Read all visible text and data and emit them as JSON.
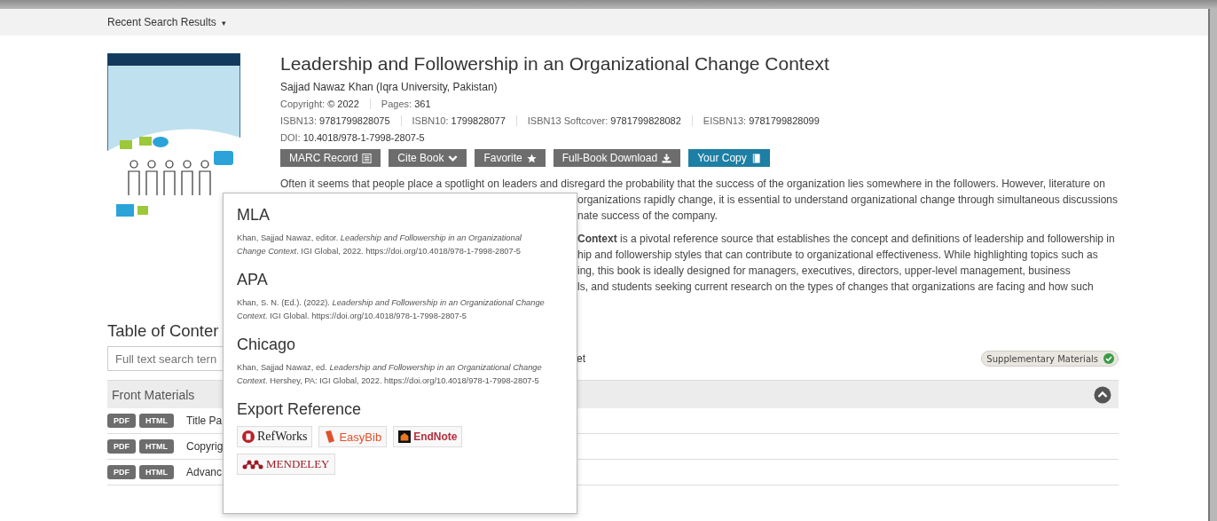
{
  "topbar": {
    "label": "Recent Search Results",
    "caret": "▾"
  },
  "book": {
    "title": "Leadership and Followership in an Organizational Change Context",
    "author": "Sajjad Nawaz Khan (Iqra University, Pakistan)",
    "meta_rows": [
      [
        {
          "label": "Copyright:",
          "value": "© 2022"
        },
        {
          "label": "Pages:",
          "value": "361"
        }
      ],
      [
        {
          "label": "ISBN13:",
          "value": "9781799828075"
        },
        {
          "label": "ISBN10:",
          "value": "1799828077"
        },
        {
          "label": "ISBN13 Softcover:",
          "value": "9781799828082"
        },
        {
          "label": "EISBN13:",
          "value": "9781799828099"
        }
      ],
      [
        {
          "label": "DOI:",
          "value": "10.4018/978-1-7998-2807-5"
        }
      ]
    ],
    "buttons": [
      {
        "label": "MARC Record",
        "kind": "list",
        "highlighted": false
      },
      {
        "label": "Cite Book",
        "kind": "dropdown",
        "highlighted": false
      },
      {
        "label": "Favorite",
        "kind": "favorite",
        "highlighted": false
      },
      {
        "label": "Full-Book Download",
        "kind": "download",
        "highlighted": false
      },
      {
        "label": "Your Copy",
        "kind": "copy",
        "highlighted": true
      }
    ],
    "description_first_line": "Often it seems that people place a spotlight on leaders and disregard the probability that the success of the organization lies somewhere in the followers. However, literature on",
    "description_fragments": [
      [
        "organizations rapidly change, it is essential to understand organizational change through simultaneous discussions",
        "nate success of the company."
      ],
      [
        "**Context** is a pivotal reference source that establishes the concept and definitions of leadership and followership in",
        "hip and followership styles that can contribute to organizational effectiveness. While highlighting topics such as",
        "ing, this book is ideally designed for managers, executives, directors, upper-level management, business",
        "ls, and students seeking current research on the types of changes that organizations are facing and how such"
      ]
    ]
  },
  "toc": {
    "heading": "Table of Conter",
    "search": {
      "placeholder": "Full text search tern"
    },
    "search_fragment": "et",
    "supplementary": "Supplementary Materials",
    "section": {
      "title": "Front Materials",
      "expanded": true
    },
    "rows": [
      {
        "formats": [
          "PDF",
          "HTML"
        ],
        "title": "Title Pa"
      },
      {
        "formats": [
          "PDF",
          "HTML"
        ],
        "title": "Copyrig"
      },
      {
        "formats": [
          "PDF",
          "HTML"
        ],
        "title": "Advanc"
      }
    ]
  },
  "cite_popup": {
    "styles": [
      {
        "name": "MLA",
        "citation": "Khan, Sajjad Nawaz, editor. *Leadership and Followership in an Organizational Change Context*. IGI Global, 2022. https://doi.org/10.4018/978-1-7998-2807-5"
      },
      {
        "name": "APA",
        "citation": "Khan, S. N. (Ed.). (2022). *Leadership and Followership in an Organizational Change Context*. IGI Global. https://doi.org/10.4018/978-1-7998-2807-5"
      },
      {
        "name": "Chicago",
        "citation": "Khan, Sajjad Nawaz, ed. *Leadership and Followership in an Organizational Change Context*. Hershey, PA: IGI Global, 2022. https://doi.org/10.4018/978-1-7998-2807-5"
      }
    ],
    "export_heading": "Export Reference",
    "exports": [
      {
        "kind": "refworks",
        "label": "RefWorks"
      },
      {
        "kind": "easybib",
        "label": "EasyBib"
      },
      {
        "kind": "endnote",
        "label": "EndNote"
      },
      {
        "kind": "mendeley",
        "label": "MENDELEY"
      }
    ]
  }
}
